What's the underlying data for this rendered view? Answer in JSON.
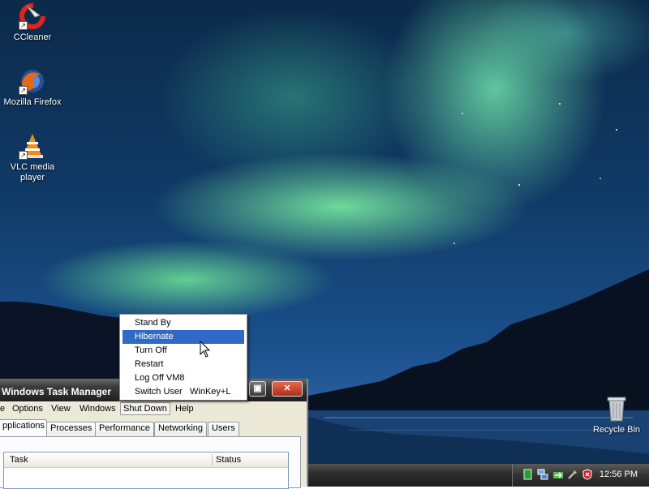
{
  "desktop": {
    "icons": [
      {
        "label": "CCleaner",
        "icon": "ccleaner-icon"
      },
      {
        "label": "Mozilla Firefox",
        "icon": "firefox-icon"
      },
      {
        "label": "VLC media player",
        "icon": "vlc-icon"
      },
      {
        "label": "Recycle Bin",
        "icon": "recycle-bin-icon"
      }
    ]
  },
  "taskbar": {
    "clock": "12:56 PM",
    "tray_icons": [
      "volume-icon",
      "network-icon",
      "network-activity-icon",
      "safely-remove-icon",
      "security-alert-icon"
    ]
  },
  "task_manager": {
    "title": "Windows Task Manager",
    "menu": [
      "e",
      "Options",
      "View",
      "Windows",
      "Shut Down",
      "Help"
    ],
    "active_menu": "Shut Down",
    "tabs": [
      "pplications",
      "Processes",
      "Performance",
      "Networking",
      "Users"
    ],
    "active_tab": "pplications",
    "columns": [
      "Task",
      "Status"
    ],
    "window_buttons": {
      "restore": "restore",
      "close": "close"
    }
  },
  "shutdown_menu": {
    "items": [
      {
        "label": "Stand By",
        "shortcut": ""
      },
      {
        "label": "Hibernate",
        "shortcut": ""
      },
      {
        "label": "Turn Off",
        "shortcut": ""
      },
      {
        "label": "Restart",
        "shortcut": ""
      },
      {
        "label": "Log Off VM8",
        "shortcut": ""
      },
      {
        "label": "Switch User",
        "shortcut": "WinKey+L"
      }
    ],
    "highlighted": "Hibernate"
  },
  "colors": {
    "menu_highlight": "#316ac5",
    "xp_beige": "#ece9d8",
    "title_bar_dark": "#1e1e1e",
    "close_button_red": "#c8432c"
  }
}
